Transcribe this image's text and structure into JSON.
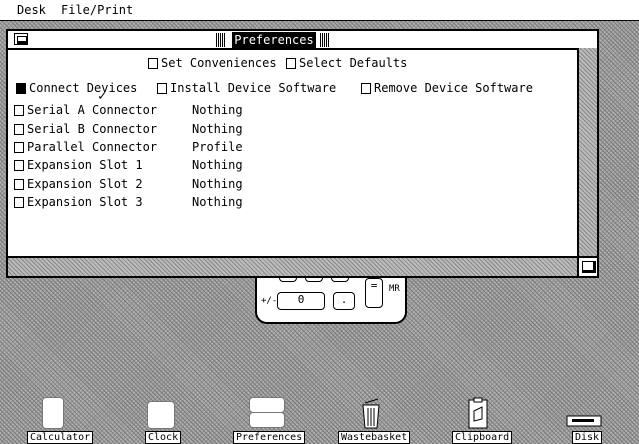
{
  "menubar": {
    "items": [
      "Desk",
      "File/Print"
    ]
  },
  "window": {
    "title": "Preferences",
    "top_options": [
      "Set Conveniences",
      "Select Defaults"
    ],
    "mode_options": [
      {
        "label": "Connect Devices",
        "selected": true
      },
      {
        "label": "Install Device Software",
        "selected": false
      },
      {
        "label": "Remove Device Software",
        "selected": false
      }
    ],
    "check_mark": "✓",
    "devices": [
      {
        "label": "Serial A Connector",
        "value": "Nothing"
      },
      {
        "label": "Serial B Connector",
        "value": "Nothing"
      },
      {
        "label": "Parallel Connector",
        "value": "Profile"
      },
      {
        "label": "Expansion Slot 1",
        "value": "Nothing"
      },
      {
        "label": "Expansion Slot 2",
        "value": "Nothing"
      },
      {
        "label": "Expansion Slot 3",
        "value": "Nothing"
      }
    ]
  },
  "calculator": {
    "keys": [
      "0",
      ".",
      "="
    ],
    "pm": "+/-",
    "mr": "MR"
  },
  "desktop_icons": [
    {
      "label": "Calculator",
      "icon": "calculator-icon"
    },
    {
      "label": "Clock",
      "icon": "clock-icon"
    },
    {
      "label": "Preferences",
      "icon": "preferences-icon"
    },
    {
      "label": "Wastebasket",
      "icon": "wastebasket-icon"
    },
    {
      "label": "Clipboard",
      "icon": "clipboard-icon"
    },
    {
      "label": "Disk",
      "icon": "disk-icon"
    }
  ]
}
